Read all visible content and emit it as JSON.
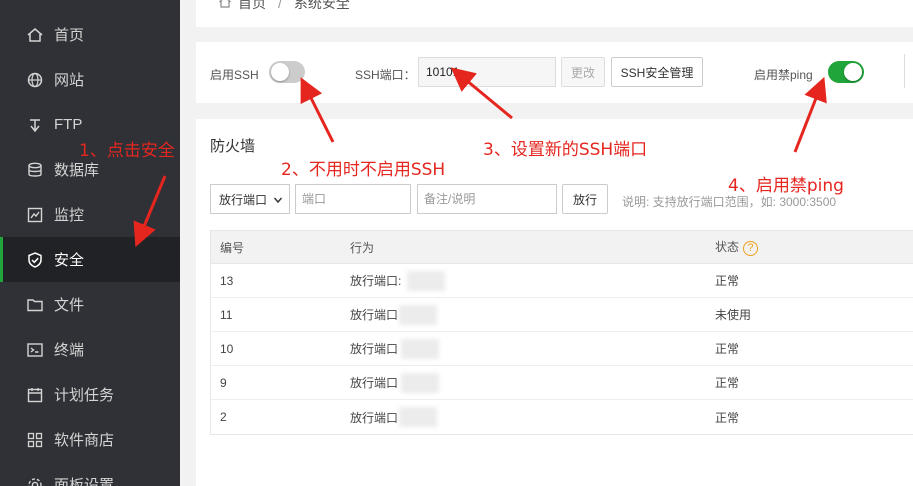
{
  "sidebar": {
    "items": [
      {
        "label": "首页",
        "icon": "home-icon",
        "active": false
      },
      {
        "label": "网站",
        "icon": "globe-icon",
        "active": false
      },
      {
        "label": "FTP",
        "icon": "ftp-icon",
        "active": false
      },
      {
        "label": "数据库",
        "icon": "database-icon",
        "active": false
      },
      {
        "label": "监控",
        "icon": "monitor-icon",
        "active": false
      },
      {
        "label": "安全",
        "icon": "shield-icon",
        "active": true
      },
      {
        "label": "文件",
        "icon": "folder-icon",
        "active": false
      },
      {
        "label": "终端",
        "icon": "terminal-icon",
        "active": false
      },
      {
        "label": "计划任务",
        "icon": "calendar-icon",
        "active": false
      },
      {
        "label": "软件商店",
        "icon": "apps-icon",
        "active": false
      },
      {
        "label": "面板设置",
        "icon": "gear-icon",
        "active": false
      }
    ]
  },
  "breadcrumb": {
    "home": "首页",
    "sep": "/",
    "current": "系统安全"
  },
  "ssh": {
    "enable_label": "启用SSH",
    "enabled": false,
    "port_label": "SSH端口：",
    "port_value": "10101",
    "change_button": "更改",
    "manage_button": "SSH安全管理",
    "ping_label": "启用禁ping",
    "ping_disabled": true
  },
  "firewall": {
    "title": "防火墙",
    "select_value": "放行端口",
    "port_placeholder": "端口",
    "note_placeholder": "备注/说明",
    "allow_button": "放行",
    "hint": "说明: 支持放行端口范围，如: 3000:3500",
    "columns": [
      "编号",
      "行为",
      "状态"
    ],
    "rows": [
      {
        "id": "13",
        "action": "放行端口:",
        "status": "正常"
      },
      {
        "id": "11",
        "action": "放行端口",
        "status": "未使用"
      },
      {
        "id": "10",
        "action": "放行端口",
        "status": "正常"
      },
      {
        "id": "9",
        "action": "放行端口",
        "status": "正常"
      },
      {
        "id": "2",
        "action": "放行端口",
        "status": "正常"
      }
    ]
  },
  "annotations": [
    "1、点击安全",
    "2、不用时不启用SSH",
    "3、设置新的SSH端口",
    "4、启用禁ping"
  ],
  "colors": {
    "sidebar_bg": "#2f3136",
    "accent_green": "#20a53a",
    "annotation_red": "#e5261f"
  }
}
